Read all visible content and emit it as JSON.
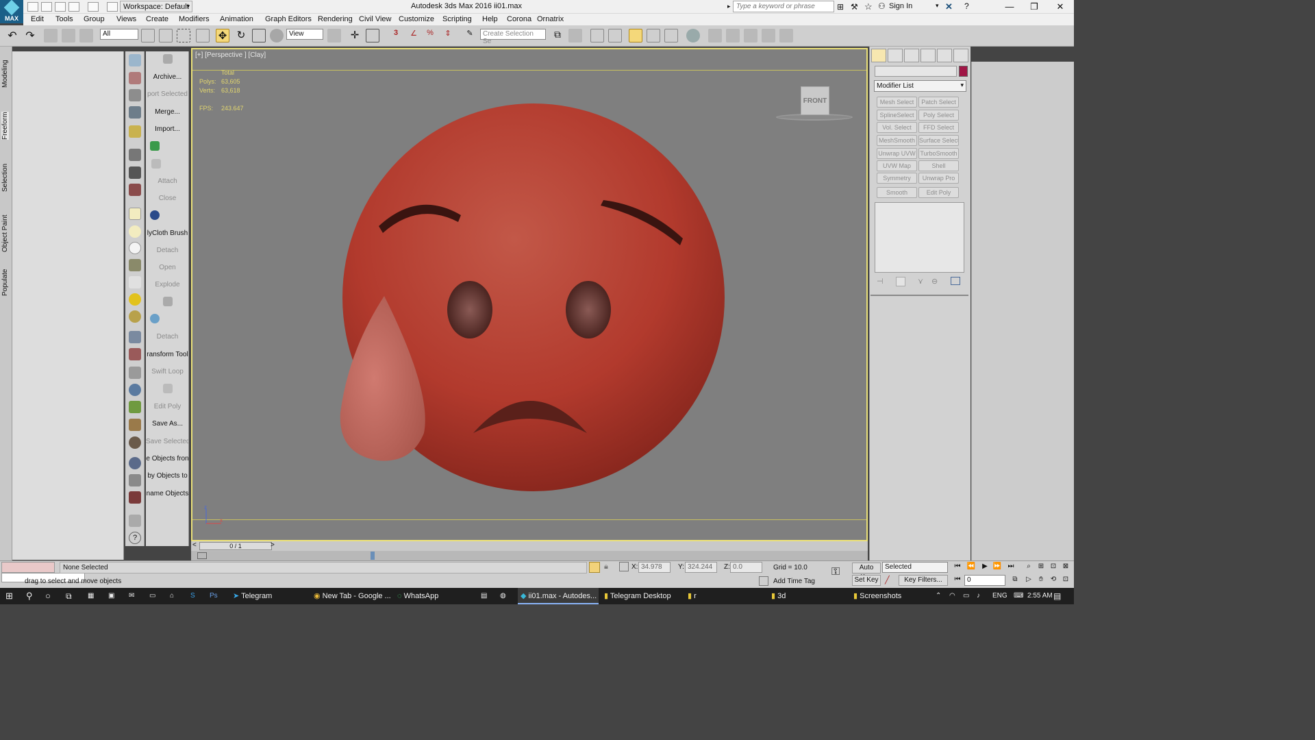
{
  "titlebar": {
    "workspace": "Workspace: Default",
    "title": "Autodesk 3ds Max 2016     ii01.max",
    "search_placeholder": "Type a keyword or phrase",
    "signin": "Sign In",
    "logo_text": "MAX"
  },
  "menu": [
    "Edit",
    "Tools",
    "Group",
    "Views",
    "Create",
    "Modifiers",
    "Animation",
    "Graph Editors",
    "Rendering",
    "Civil View",
    "Customize",
    "Scripting",
    "Help",
    "Corona",
    "Ornatrix"
  ],
  "toolbar": {
    "filter": "All",
    "refcoord": "View",
    "selection_set": "Create Selection Se"
  },
  "left_tabs": [
    "Modeling",
    "Freeform",
    "Selection",
    "Object Paint",
    "Populate"
  ],
  "script_items": [
    {
      "label": "Archive...",
      "disabled": false
    },
    {
      "label": "port Selected",
      "disabled": true
    },
    {
      "label": "Merge...",
      "disabled": false
    },
    {
      "label": "Import...",
      "disabled": false
    },
    {
      "label": "Attach",
      "disabled": true
    },
    {
      "label": "Close",
      "disabled": true
    },
    {
      "label": "lyCloth Brush",
      "disabled": false
    },
    {
      "label": "Detach",
      "disabled": true
    },
    {
      "label": "Open",
      "disabled": true
    },
    {
      "label": "Explode",
      "disabled": true
    },
    {
      "label": "Detach",
      "disabled": true
    },
    {
      "label": "ransform Tool",
      "disabled": false
    },
    {
      "label": "Swift Loop",
      "disabled": true
    },
    {
      "label": "Edit Poly",
      "disabled": true
    },
    {
      "label": "Save As...",
      "disabled": false
    },
    {
      "label": "Save Selected",
      "disabled": true
    },
    {
      "label": "e Objects fron",
      "disabled": false
    },
    {
      "label": "by Objects to",
      "disabled": false
    },
    {
      "label": "name Objects",
      "disabled": false
    }
  ],
  "viewport": {
    "label": "[+] [Perspective ] [Clay]",
    "stats_header": "Total",
    "polys_label": "Polys:",
    "polys": "63,605",
    "verts_label": "Verts:",
    "verts": "63,618",
    "fps_label": "FPS:",
    "fps": "243.647",
    "viewcube": "FRONT"
  },
  "command_panel": {
    "modifier_list": "Modifier List",
    "object_color": "#a01646",
    "modifiers": [
      "Mesh Select",
      "Patch Select",
      "SplineSelect",
      "Poly Select",
      "Vol. Select",
      "FFD Select",
      "MeshSmooth",
      "Surface Select",
      "Unwrap UVW",
      "TurboSmooth",
      "UVW Map",
      "Shell",
      "Symmetry",
      "Unwrap Pro",
      "Smooth",
      "Edit Poly"
    ]
  },
  "timeline": {
    "frame": "0 / 1",
    "prev": "<",
    "next": ">"
  },
  "status": {
    "selection": "None Selected",
    "prompt": "drag to select and move objects",
    "x_label": "X:",
    "x": "34.978",
    "y_label": "Y:",
    "y": "324.244",
    "z_label": "Z:",
    "z": "0.0",
    "grid": "Grid = 10.0",
    "add_time_tag": "Add Time Tag",
    "auto_key": "Auto Key",
    "set_key": "Set Key",
    "selected": "Selected",
    "key_filters": "Key Filters...",
    "frame_value": "0"
  },
  "taskbar": {
    "items": [
      "Telegram",
      "New Tab - Google ...",
      "WhatsApp",
      "ii01.max - Autodes...",
      "Telegram Desktop",
      "r",
      "3d",
      "Screenshots"
    ],
    "lang": "ENG",
    "time": "2:55 AM"
  },
  "colors": {
    "viewport_bg": "#7f7f7f",
    "viewport_border": "#ece27a",
    "emoji_red": "#b23a2d"
  }
}
